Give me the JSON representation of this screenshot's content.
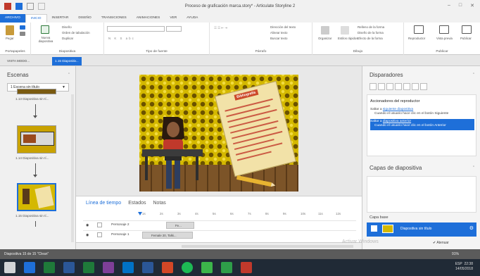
{
  "title": "Proceso de graficación marca.story* - Articulate Storyline 2",
  "window_controls": [
    "–",
    "□",
    "✕"
  ],
  "ribbon_tabs": [
    "ARCHIVO",
    "INICIO",
    "INSERTAR",
    "DISEÑO",
    "TRANSICIONES",
    "ANIMACIONES",
    "VER",
    "AYUDA"
  ],
  "active_tab": "INICIO",
  "ribbon": {
    "portapapeles": {
      "label": "Portapapeles",
      "paste": "Pegar"
    },
    "diapositiva": {
      "label": "Diapositiva",
      "new_slide": "Nueva diapositiva",
      "design": "Diseño",
      "order": "Orden de tabulación",
      "duplicate": "Duplicar"
    },
    "font": {
      "label": "Tipo de fuente"
    },
    "paragraph": {
      "label": "Párrafo",
      "text_dir": "Dirección del texto",
      "align_text": "Alinear texto",
      "search": "Buscar texto"
    },
    "drawing": {
      "label": "Dibujo",
      "organize": "Organizar",
      "styles": "Estilos rápidos",
      "fill": "Relleno de la forma",
      "outline": "Diseño de la forma",
      "effect": "Efecto de la forma"
    },
    "publish": {
      "label": "Publicar",
      "preview_player": "Reproductor",
      "preview": "Vista previa",
      "publish": "Publicar"
    }
  },
  "doc_tabs": [
    "VISTA MODO...",
    "1.15 Diapositiv..."
  ],
  "scenes": {
    "title": "Escenas",
    "selector": "1 Escena sin título",
    "thumbs": [
      {
        "label": "1.13 Diapositiva sin tí..."
      },
      {
        "label": "1.14 Diapositiva sin tí..."
      },
      {
        "label": "1.15 Diapositiva sin tí..."
      }
    ]
  },
  "slide": {
    "paper_title": "Bibliografía"
  },
  "timeline": {
    "tabs": [
      "Línea de tiempo",
      "Estados",
      "Notas"
    ],
    "active": "Línea de tiempo",
    "ruler": [
      "1s",
      "2s",
      "3s",
      "4s",
      "5s",
      "6s",
      "7s",
      "8s",
      "9s",
      "10s",
      "11s",
      "12s"
    ],
    "rows": [
      {
        "name": "Personaje 2",
        "bar": "Fe..."
      },
      {
        "name": "Personaje 1",
        "bar": "Female 20, Talki..."
      }
    ]
  },
  "triggers": {
    "title": "Disparadores",
    "group": "Accionadores del reproductor",
    "items": [
      {
        "action": "Saltar a",
        "target": "siguiente diapositiva",
        "condition": "Cuando el usuario hace clic en el botón Siguiente"
      },
      {
        "action": "Saltar a",
        "target": "diapositiva anterior",
        "condition": "Cuando el usuario hace clic en el botón Anterior"
      }
    ]
  },
  "layers": {
    "title": "Capas de diapositiva",
    "base_title": "Capa base",
    "base_name": "Diapositiva sin título",
    "dim_label": "Atenuar"
  },
  "watermark": "Activar Windows",
  "statusbar": {
    "left": "Diapositiva 15 de 15   \"Clean\"",
    "zoom": "91%"
  },
  "taskbar": {
    "time": "22:38",
    "date": "14/05/2018",
    "lang": "ESP"
  },
  "colors": {
    "accent": "#1e6fd9",
    "statusbar": "#5b5b5b",
    "taskbar": "#202a36"
  }
}
